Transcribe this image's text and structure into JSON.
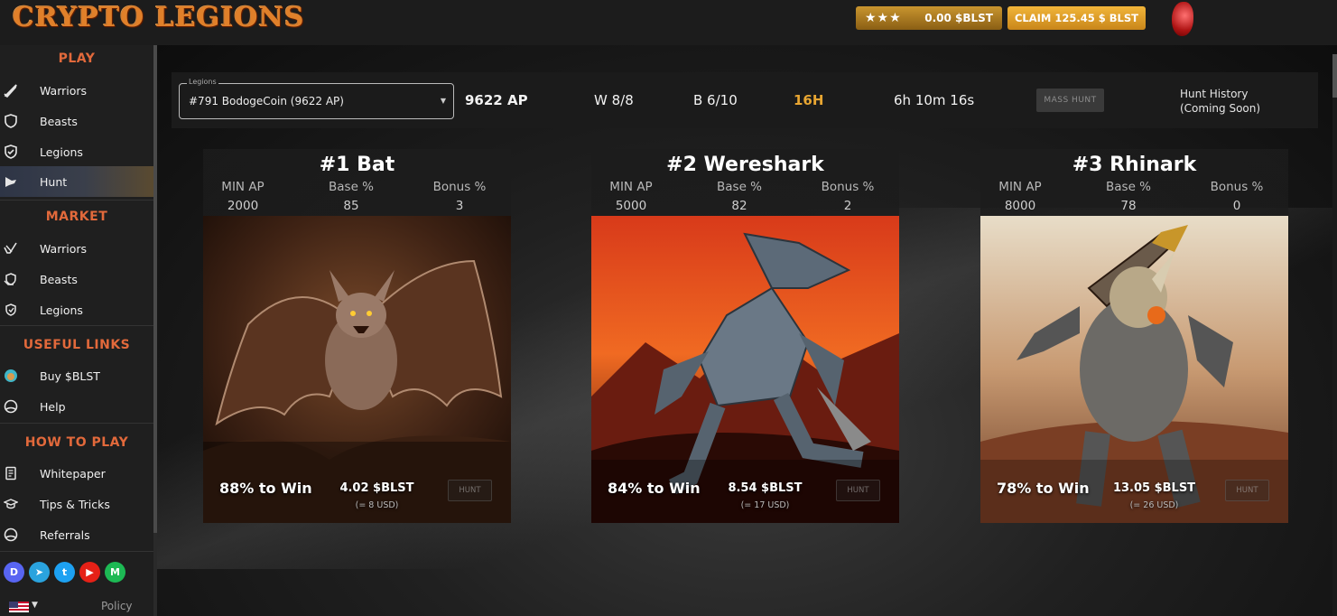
{
  "app": {
    "logo": "CRYPTO LEGIONS"
  },
  "header": {
    "stars": "★★★",
    "balance": "0.00 $BLST",
    "claim_label": "CLAIM 125.45 $ BLST"
  },
  "sidebar": {
    "play_title": "PLAY",
    "play_items": [
      {
        "label": "Warriors",
        "icon": "sword-icon"
      },
      {
        "label": "Beasts",
        "icon": "shield-icon"
      },
      {
        "label": "Legions",
        "icon": "legion-shield-icon"
      },
      {
        "label": "Hunt",
        "icon": "hunt-icon"
      }
    ],
    "market_title": "MARKET",
    "market_items": [
      {
        "label": "Warriors",
        "icon": "market-sword-icon"
      },
      {
        "label": "Beasts",
        "icon": "market-beast-icon"
      },
      {
        "label": "Legions",
        "icon": "market-legion-icon"
      }
    ],
    "links_title": "USEFUL LINKS",
    "links_items": [
      {
        "label": "Buy $BLST",
        "icon": "pancakeswap-icon"
      },
      {
        "label": "Help",
        "icon": "help-icon"
      }
    ],
    "howto_title": "HOW TO PLAY",
    "howto_items": [
      {
        "label": "Whitepaper",
        "icon": "document-icon"
      },
      {
        "label": "Tips & Tricks",
        "icon": "graduation-cap-icon"
      },
      {
        "label": "Referrals",
        "icon": "referral-icon"
      }
    ],
    "social": [
      {
        "name": "discord-icon",
        "glyph": "D",
        "color": "#5865f2"
      },
      {
        "name": "telegram-icon",
        "glyph": "➤",
        "color": "#2aa3de"
      },
      {
        "name": "twitter-icon",
        "glyph": "t",
        "color": "#1da1f2"
      },
      {
        "name": "youtube-icon",
        "glyph": "▶",
        "color": "#e62117"
      },
      {
        "name": "medium-icon",
        "glyph": "M",
        "color": "#1db954"
      }
    ],
    "policy": "Policy"
  },
  "hunt_bar": {
    "select_label": "Legions",
    "selected_legion": "#791 BodogeCoin (9622 AP)",
    "ap": "9622 AP",
    "warriors": "W 8/8",
    "beasts": "B 6/10",
    "hours": "16H",
    "timer": "6h 10m 16s",
    "mass_hunt_label": "MASS HUNT",
    "history_label": "Hunt History (Coming Soon)"
  },
  "monsters": [
    {
      "title": "#1 Bat",
      "min_ap_label": "MIN AP",
      "base_label": "Base %",
      "bonus_label": "Bonus %",
      "min_ap": "2000",
      "base": "85",
      "bonus": "3",
      "win": "88% to Win",
      "reward": "4.02 $BLST",
      "usd": "(= 8 USD)",
      "hunt_label": "HUNT"
    },
    {
      "title": "#2 Wereshark",
      "min_ap_label": "MIN AP",
      "base_label": "Base %",
      "bonus_label": "Bonus %",
      "min_ap": "5000",
      "base": "82",
      "bonus": "2",
      "win": "84% to Win",
      "reward": "8.54 $BLST",
      "usd": "(= 17 USD)",
      "hunt_label": "HUNT"
    },
    {
      "title": "#3 Rhinark",
      "min_ap_label": "MIN AP",
      "base_label": "Base %",
      "bonus_label": "Bonus %",
      "min_ap": "8000",
      "base": "78",
      "bonus": "0",
      "win": "78% to Win",
      "reward": "13.05 $BLST",
      "usd": "(= 26 USD)",
      "hunt_label": "HUNT"
    }
  ],
  "colors": {
    "accent_orange": "#e2693b",
    "gold": "#e8a632",
    "claim": "#f1b539"
  }
}
